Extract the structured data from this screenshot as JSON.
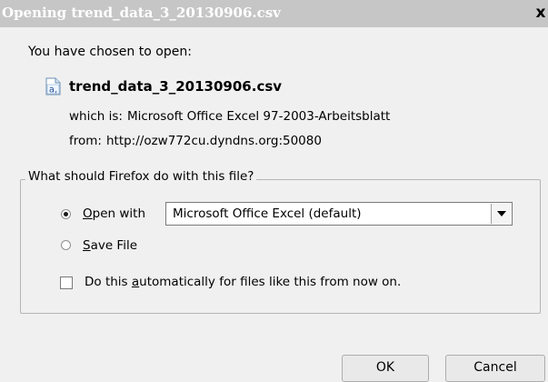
{
  "window": {
    "title": "Opening trend_data_3_20130906.csv",
    "close_glyph": "x"
  },
  "prompt": {
    "chosen_label": "You have chosen to open:",
    "file_icon": "csv-file-icon",
    "file_name": "trend_data_3_20130906.csv",
    "which_is_label": "which is:",
    "which_is_value": "Microsoft Office Excel 97-2003-Arbeitsblatt",
    "from_label": "from:",
    "from_value": "http://ozw772cu.dyndns.org:50080"
  },
  "action_group": {
    "legend": "What should Firefox do with this file?",
    "open_with": {
      "label": "Open with",
      "selected": true,
      "app_value": "Microsoft Office Excel (default)"
    },
    "save_file": {
      "label": "Save File",
      "selected": false
    },
    "auto": {
      "label": "Do this automatically for files like this from now on.",
      "checked": false
    }
  },
  "buttons": {
    "ok": "OK",
    "cancel": "Cancel"
  }
}
